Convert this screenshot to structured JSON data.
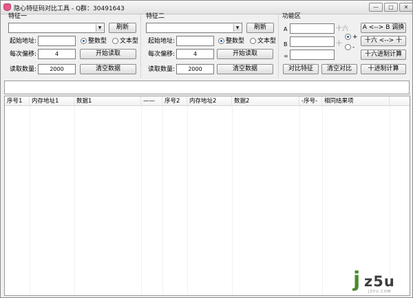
{
  "window": {
    "title": "隐心特征码对比工具 - Q群：30491643",
    "controls": {
      "minimize": "—",
      "maximize": "□",
      "close": "✕"
    }
  },
  "group1": {
    "title": "特征一",
    "refresh": "刷新",
    "start_addr_label": "起始地址:",
    "start_addr_value": "",
    "offset_label": "每次偏移:",
    "offset_value": "4",
    "count_label": "读取数量:",
    "count_value": "2000",
    "radio_int": "整数型",
    "radio_text": "文本型",
    "start_read": "开始读取",
    "clear": "清空数据"
  },
  "group2": {
    "title": "特征二",
    "refresh": "刷新",
    "start_addr_label": "起始地址:",
    "start_addr_value": "",
    "offset_label": "每次偏移:",
    "offset_value": "4",
    "count_label": "读取数量:",
    "count_value": "2000",
    "radio_int": "整数型",
    "radio_text": "文本型",
    "start_read": "开始读取",
    "clear": "清空数据"
  },
  "func": {
    "title": "功能区",
    "label_a": "A",
    "label_b": "B",
    "label_eq": "=",
    "hex_hint1": "十六",
    "hex_hint2": "十",
    "plus": "+",
    "minus": "-",
    "swap_ab": "A <--> B 调换",
    "hex_dec": "十六 <--> 十",
    "hex_calc": "十六进制计算",
    "dec_calc": "十进制计算",
    "compare": "对比特征",
    "clear_compare": "清空对比"
  },
  "table": {
    "columns": [
      "序号1",
      "内存地址1",
      "数据1",
      "——",
      "序号2",
      "内存地址2",
      "数据2",
      "-序号-",
      "相同结果项"
    ]
  },
  "watermark": {
    "j": "j",
    "rest": "z5u",
    "sub": "JZ5U.COM"
  }
}
